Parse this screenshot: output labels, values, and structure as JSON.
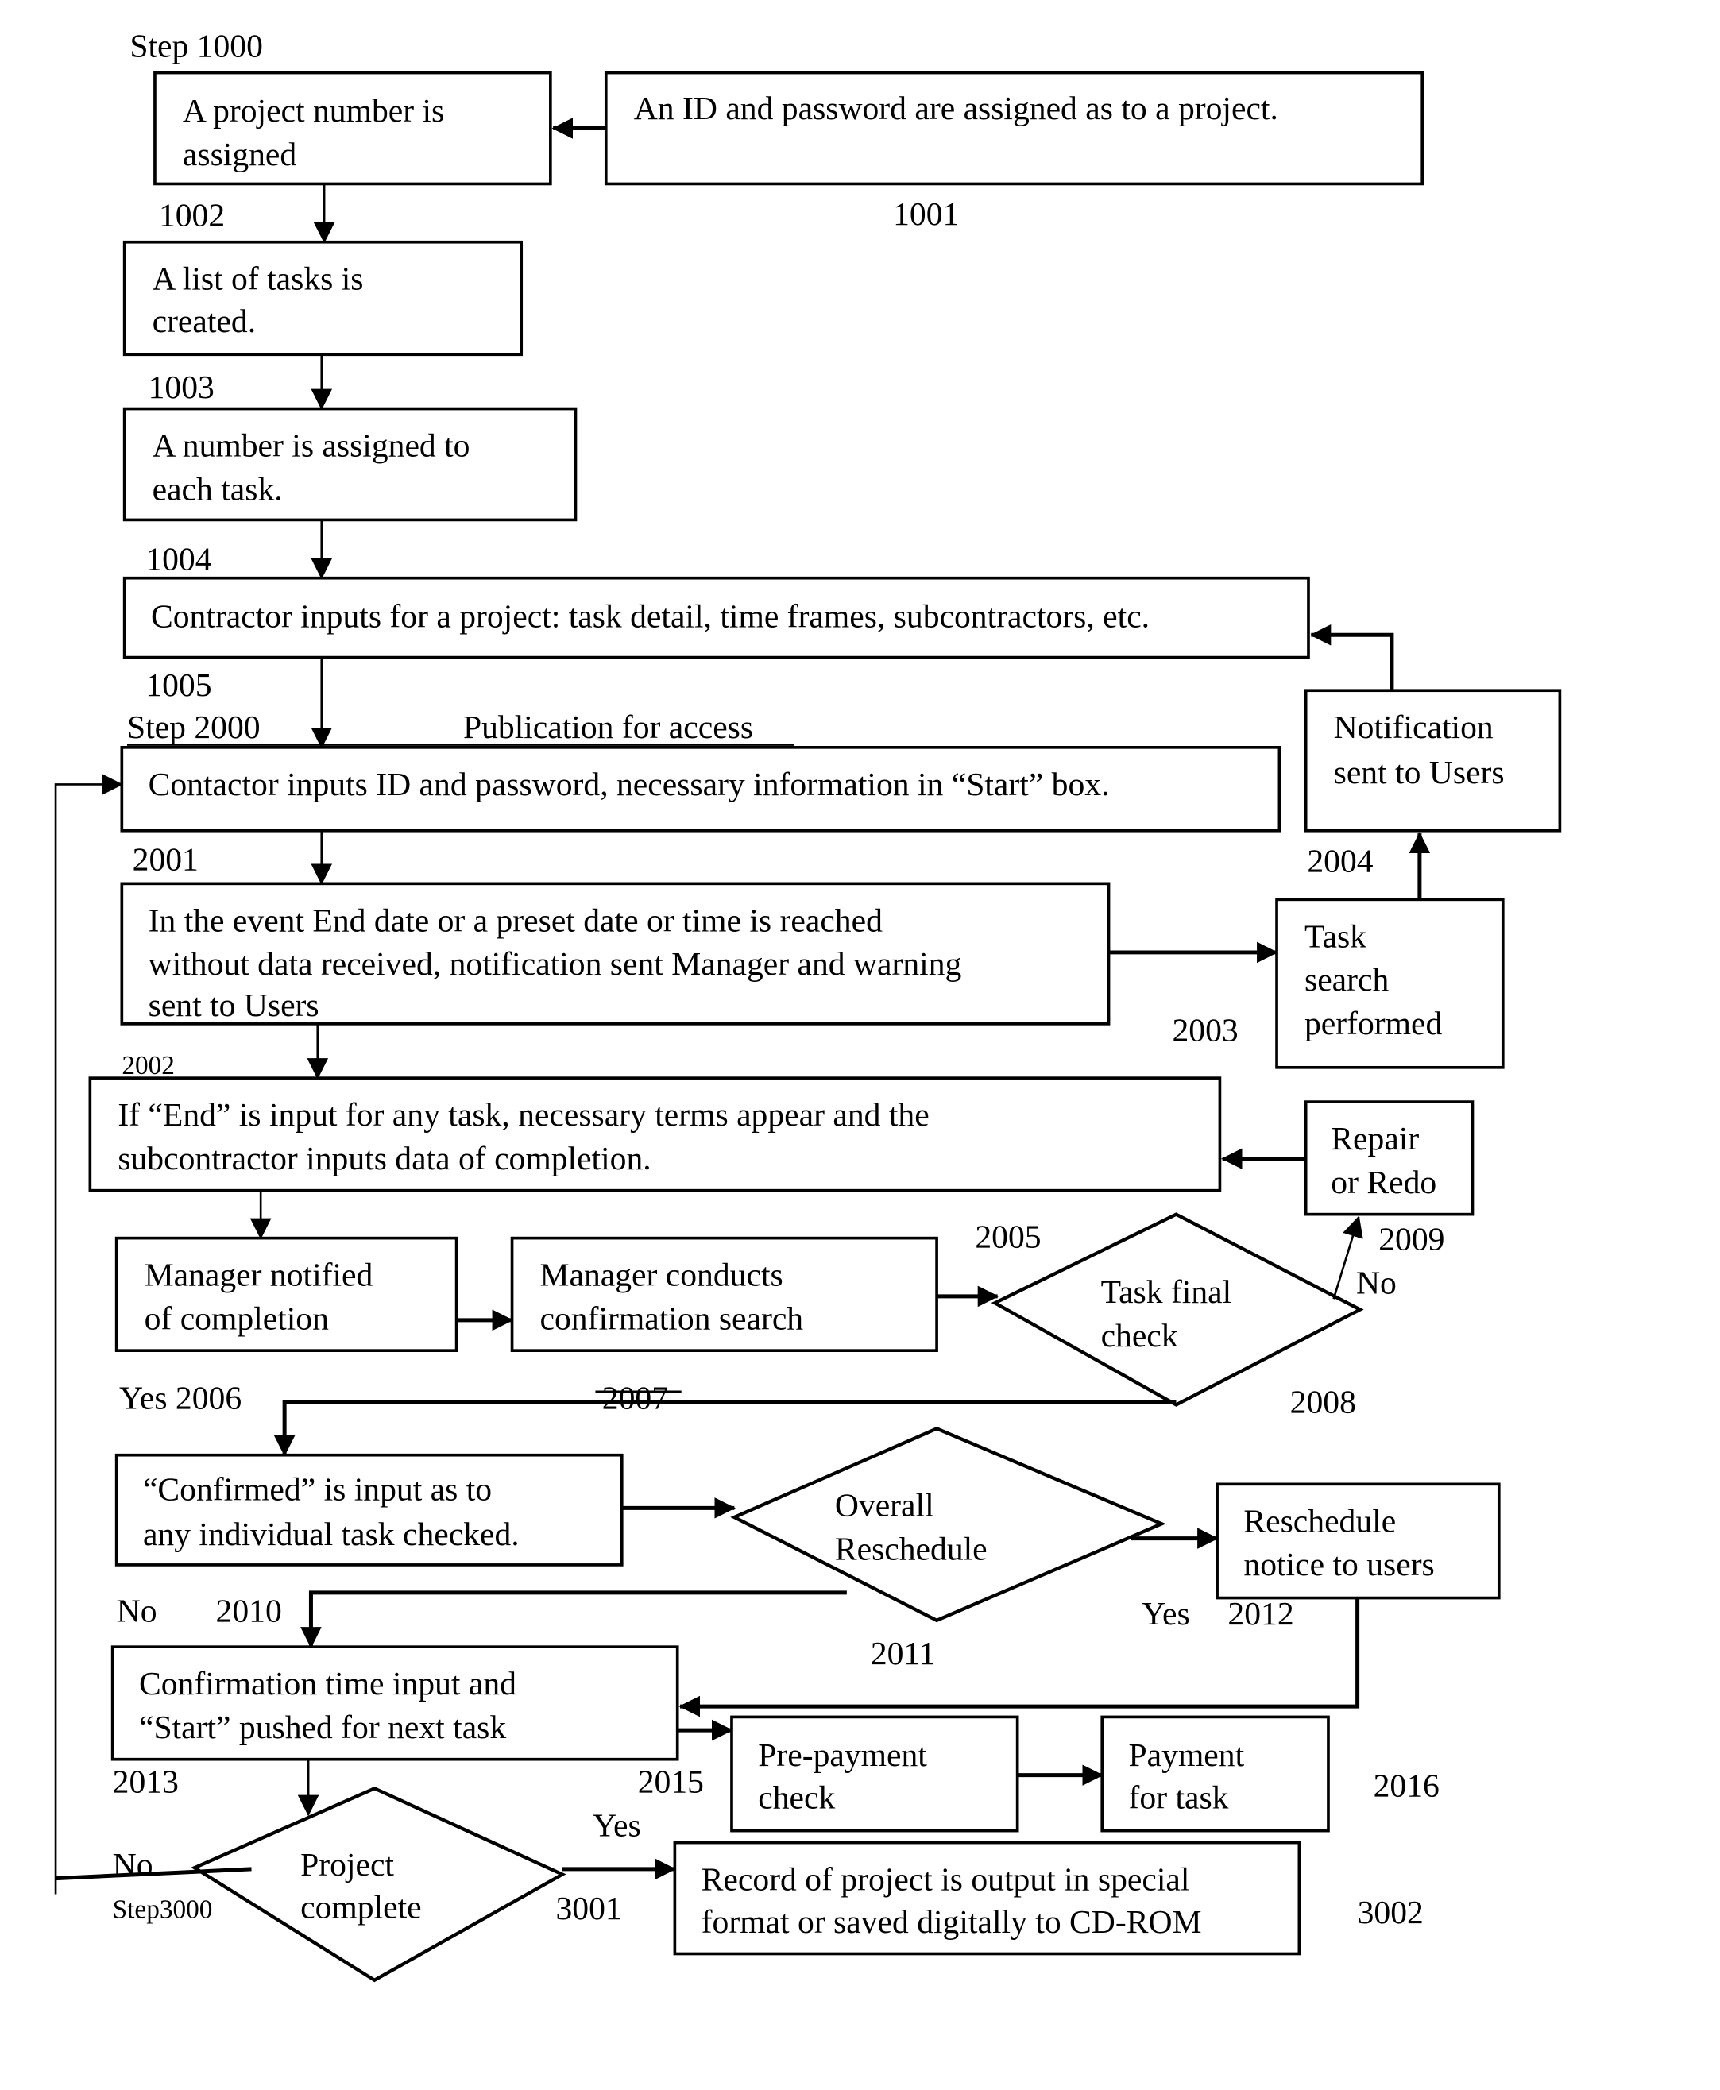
{
  "diagram": {
    "type": "flowchart",
    "labels": {
      "step1000": "Step 1000",
      "step2000": "Step 2000",
      "step3000": "Step3000",
      "publication": "Publication for access",
      "n1001": "1001",
      "n1002": "1002",
      "n1003": "1003",
      "n1004": "1004",
      "n1005": "1005",
      "n2001": "2001",
      "n2002": "2002",
      "n2003": "2003",
      "n2004": "2004",
      "n2005": "2005",
      "yes2006": "Yes 2006",
      "n2007": "2007",
      "n2008": "2008",
      "n2009": "2009",
      "no_2009": "No",
      "no": "No",
      "n2010": "2010",
      "n2011": "2011",
      "yes": "Yes",
      "n2012": "2012",
      "n2013": "2013",
      "n2015": "2015",
      "n2016": "2016",
      "yes3001": "Yes",
      "n3001": "3001",
      "n3002": "3002",
      "no3000": "No"
    },
    "nodes": {
      "project_number": [
        "A project number is",
        "assigned"
      ],
      "id_password": [
        "An ID and password are assigned as to a project."
      ],
      "task_list": [
        "A list of tasks is",
        "created."
      ],
      "task_number": [
        "A number is assigned to",
        "each task."
      ],
      "contractor_inputs": [
        "Contractor inputs for a project: task detail, time frames, subcontractors, etc."
      ],
      "start_box": [
        "Contactor inputs ID and password, necessary information in “Start” box."
      ],
      "notification": [
        "Notification",
        "sent to Users"
      ],
      "end_date_event": [
        "In the event End date or a preset date or time is reached",
        "without data received, notification sent Manager and warning",
        "sent to Users"
      ],
      "task_search": [
        "Task",
        "search",
        "performed"
      ],
      "end_input": [
        "If “End” is input for any task, necessary terms appear and the",
        "subcontractor inputs data of completion."
      ],
      "repair": [
        "Repair",
        "or Redo"
      ],
      "manager_notified": [
        "Manager notified",
        "of completion"
      ],
      "manager_search": [
        "Manager conducts",
        "confirmation search"
      ],
      "task_final_check": [
        "Task final",
        "check"
      ],
      "confirmed": [
        "“Confirmed” is input as to",
        "any individual task checked."
      ],
      "overall_reschedule": [
        "Overall",
        "Reschedule"
      ],
      "reschedule_notice": [
        "Reschedule",
        "notice to users"
      ],
      "confirmation_time": [
        "Confirmation time input and",
        "“Start” pushed for next task"
      ],
      "prepayment": [
        "Pre-payment",
        "check"
      ],
      "payment": [
        "Payment",
        "for task"
      ],
      "project_complete": [
        "Project",
        "complete"
      ],
      "record": [
        "Record of project is output in special",
        "format or saved digitally to CD-ROM"
      ]
    }
  }
}
